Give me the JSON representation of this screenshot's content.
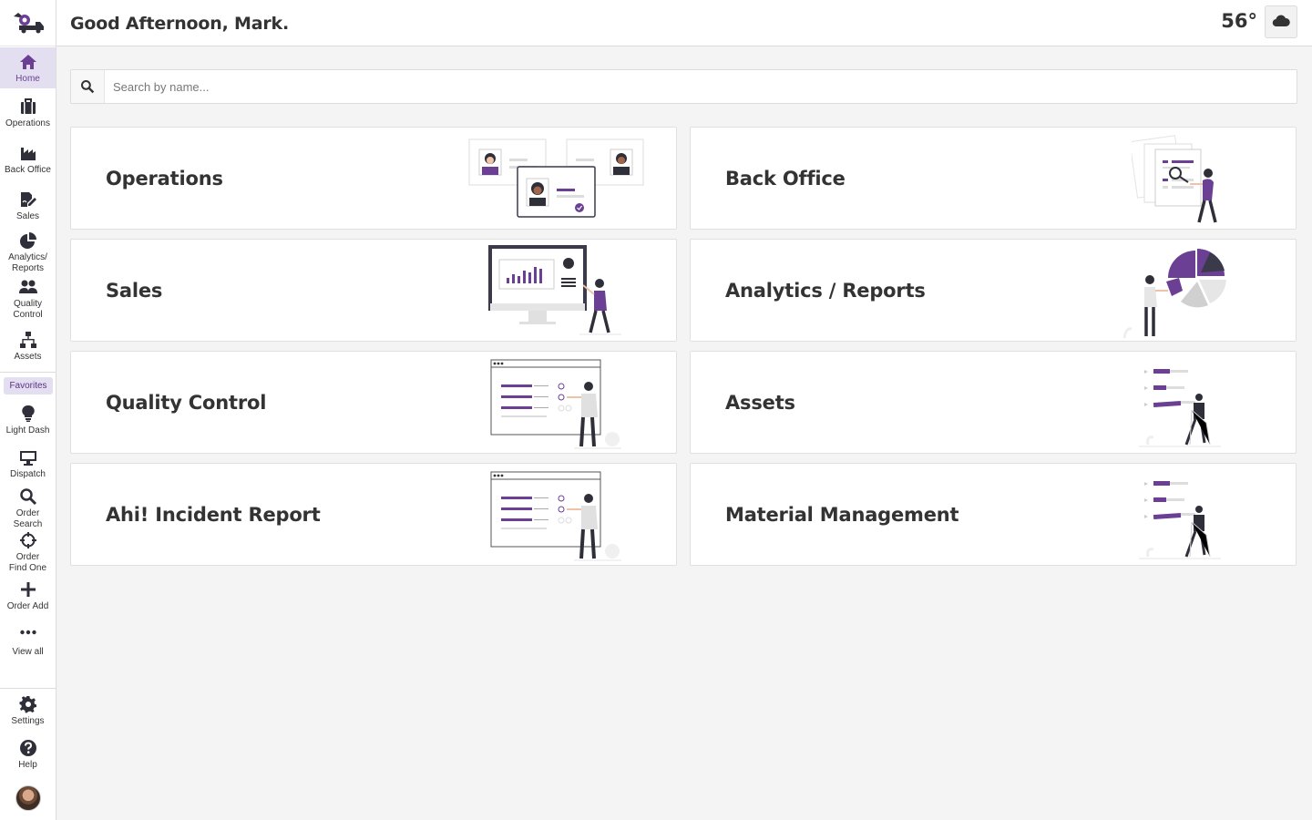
{
  "header": {
    "greeting": "Good Afternoon, Mark.",
    "temperature": "56°",
    "weather_icon": "cloud-icon"
  },
  "search": {
    "placeholder": "Search by name..."
  },
  "sidebar": {
    "items": [
      {
        "label": "Home",
        "icon": "home-icon",
        "active": true
      },
      {
        "label": "Operations",
        "icon": "briefcase-icon"
      },
      {
        "label": "Back Office",
        "icon": "industry-icon"
      },
      {
        "label": "Sales",
        "icon": "file-signature-icon"
      },
      {
        "label": "Analytics/\nReports",
        "icon": "pie-chart-icon"
      },
      {
        "label": "Quality\nControl",
        "icon": "users-icon"
      },
      {
        "label": "Assets",
        "icon": "network-icon"
      }
    ],
    "favorites_label": "Favorites",
    "favorites": [
      {
        "label": "Light Dash",
        "icon": "lightbulb-icon"
      },
      {
        "label": "Dispatch",
        "icon": "desktop-icon"
      },
      {
        "label": "Order\nSearch",
        "icon": "search-icon"
      },
      {
        "label": "Order\nFind One",
        "icon": "crosshairs-icon"
      },
      {
        "label": "Order Add",
        "icon": "plus-icon"
      },
      {
        "label": "View all",
        "icon": "ellipsis-icon"
      }
    ],
    "bottom": [
      {
        "label": "Settings",
        "icon": "gear-icon"
      },
      {
        "label": "Help",
        "icon": "question-icon"
      }
    ]
  },
  "cards": [
    {
      "title": "Operations"
    },
    {
      "title": "Back Office"
    },
    {
      "title": "Sales"
    },
    {
      "title": "Analytics / Reports"
    },
    {
      "title": "Quality Control"
    },
    {
      "title": "Assets"
    },
    {
      "title": "Ahi! Incident Report"
    },
    {
      "title": "Material Management"
    }
  ],
  "colors": {
    "accent": "#6a3f94",
    "accent_light": "#e4dff0",
    "background": "#f4f4f4"
  }
}
